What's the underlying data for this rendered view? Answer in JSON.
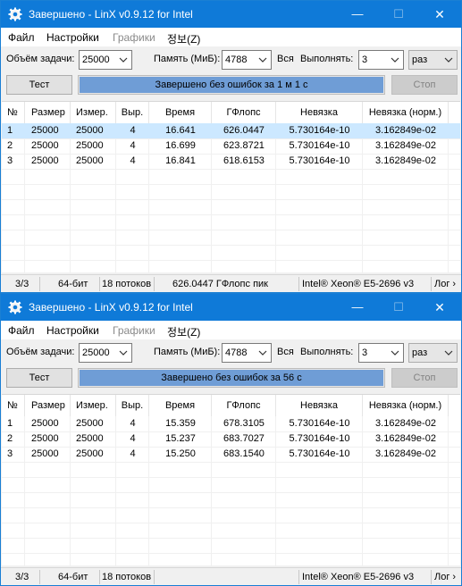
{
  "windows": [
    {
      "title": "Завершено - LinX v0.9.12 for Intel",
      "title_controls": {
        "minimize": "—",
        "maximize": "☐",
        "close": "✕"
      },
      "menu": [
        {
          "label": "Файл",
          "enabled": true
        },
        {
          "label": "Настройки",
          "enabled": true
        },
        {
          "label": "Графики",
          "enabled": false
        },
        {
          "label": "정보(Z)",
          "enabled": true
        }
      ],
      "controls": {
        "problem_size_label": "Объём задачи:",
        "problem_size_value": "25000",
        "memory_label": "Память (МиБ):",
        "memory_value": "4788",
        "all_label": "Вся",
        "run_label": "Выполнять:",
        "run_value": "3",
        "run_unit_value": "раз"
      },
      "buttons": {
        "test": "Тест",
        "stop": "Стоп"
      },
      "progress": {
        "text": "Завершено без ошибок за 1 м 1 с",
        "percent": 100
      },
      "columns": [
        "№",
        "Размер",
        "Измер.",
        "Выр.",
        "Время",
        "ГФлопс",
        "Невязка",
        "Невязка (норм.)"
      ],
      "rows": [
        [
          "1",
          "25000",
          "25000",
          "4",
          "16.641",
          "626.0447",
          "5.730164e-10",
          "3.162849e-02"
        ],
        [
          "2",
          "25000",
          "25000",
          "4",
          "16.699",
          "623.8721",
          "5.730164e-10",
          "3.162849e-02"
        ],
        [
          "3",
          "25000",
          "25000",
          "4",
          "16.841",
          "618.6153",
          "5.730164e-10",
          "3.162849e-02"
        ]
      ],
      "selected_row": 0,
      "status": {
        "count": "3/3",
        "bits": "64-бит",
        "threads": "18 потоков",
        "peak": "626.0447 ГФлопс пик",
        "cpu": "Intel® Xeon® E5-2696 v3",
        "log": "Лог ›"
      }
    },
    {
      "title": "Завершено - LinX v0.9.12 for Intel",
      "title_controls": {
        "minimize": "—",
        "maximize": "☐",
        "close": "✕"
      },
      "menu": [
        {
          "label": "Файл",
          "enabled": true
        },
        {
          "label": "Настройки",
          "enabled": true
        },
        {
          "label": "Графики",
          "enabled": false
        },
        {
          "label": "정보(Z)",
          "enabled": true
        }
      ],
      "controls": {
        "problem_size_label": "Объём задачи:",
        "problem_size_value": "25000",
        "memory_label": "Память (МиБ):",
        "memory_value": "4788",
        "all_label": "Вся",
        "run_label": "Выполнять:",
        "run_value": "3",
        "run_unit_value": "раз"
      },
      "buttons": {
        "test": "Тест",
        "stop": "Стоп"
      },
      "progress": {
        "text": "Завершено без ошибок за 56 с",
        "percent": 100
      },
      "columns": [
        "№",
        "Размер",
        "Измер.",
        "Выр.",
        "Время",
        "ГФлопс",
        "Невязка",
        "Невязка (норм.)"
      ],
      "rows": [
        [
          "1",
          "25000",
          "25000",
          "4",
          "15.359",
          "678.3105",
          "5.730164e-10",
          "3.162849e-02"
        ],
        [
          "2",
          "25000",
          "25000",
          "4",
          "15.237",
          "683.7027",
          "5.730164e-10",
          "3.162849e-02"
        ],
        [
          "3",
          "25000",
          "25000",
          "4",
          "15.250",
          "683.1540",
          "5.730164e-10",
          "3.162849e-02"
        ]
      ],
      "selected_row": null,
      "status": {
        "count": "3/3",
        "bits": "64-бит",
        "threads": "18 потоков",
        "peak": "",
        "cpu": "Intel® Xeon® E5-2696 v3",
        "log": "Лог ›"
      }
    }
  ],
  "colors": {
    "titlebar": "#0f7ad8",
    "progress_fill": "#6f9dd6",
    "selected_row": "#cce8ff"
  }
}
